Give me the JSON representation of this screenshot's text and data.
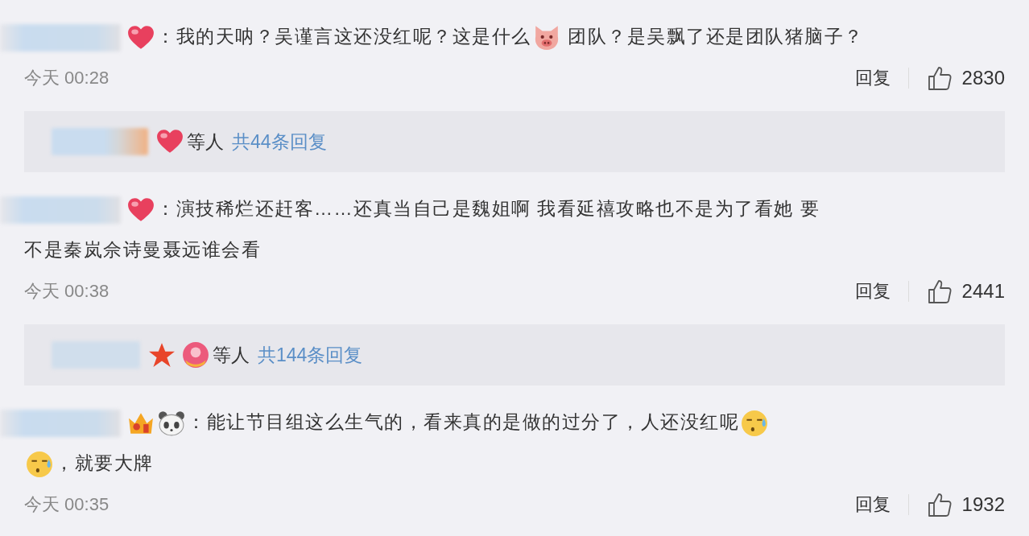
{
  "comments": [
    {
      "lines": [
        [
          {
            "kind": "heart"
          },
          {
            "kind": "text",
            "text": "：我的天呐？吴谨言这还没红呢？这是什么"
          },
          {
            "kind": "pig"
          },
          {
            "kind": "text",
            "text": " 团队？是吴飘了还是团队猪脑子？"
          }
        ]
      ],
      "time": "今天 00:28",
      "reply_label": "回复",
      "likes": "2830",
      "replies": {
        "badges": [
          {
            "kind": "heart"
          }
        ],
        "suffix": "等人",
        "link": "共44条回复"
      }
    },
    {
      "lines": [
        [
          {
            "kind": "heart"
          },
          {
            "kind": "text",
            "text": "：演技稀烂还赶客……还真当自己是魏姐啊 我看延禧攻略也不是为了看她 要"
          }
        ],
        [
          {
            "kind": "text",
            "text": "不是秦岚佘诗曼聂远谁会看"
          }
        ]
      ],
      "time": "今天 00:38",
      "reply_label": "回复",
      "likes": "2441",
      "replies": {
        "badges": [
          {
            "kind": "star"
          },
          {
            "kind": "ring"
          }
        ],
        "suffix": "等人",
        "link": "共144条回复"
      }
    },
    {
      "lines": [
        [
          {
            "kind": "crown"
          },
          {
            "kind": "panda"
          },
          {
            "kind": "text",
            "text": "：能让节目组这么生气的，看来真的是做的过分了，人还没红呢"
          },
          {
            "kind": "sweat"
          }
        ],
        [
          {
            "kind": "sweat"
          },
          {
            "kind": "text",
            "text": "，就要大牌"
          }
        ]
      ],
      "time": "今天 00:35",
      "reply_label": "回复",
      "likes": "1932"
    }
  ]
}
